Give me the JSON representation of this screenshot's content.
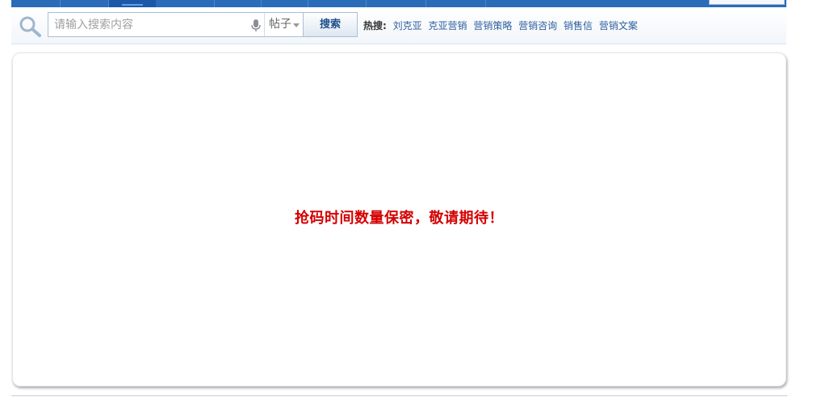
{
  "search": {
    "placeholder": "请输入搜索内容",
    "scope": "帖子",
    "button_label": "搜索"
  },
  "hot_search": {
    "label": "热搜:",
    "links": [
      "刘克亚",
      "克亚营销",
      "营销策略",
      "营销咨询",
      "销售信",
      "营销文案"
    ]
  },
  "content": {
    "notice": "抢码时间数量保密，敬请期待！"
  },
  "colors": {
    "nav_blue": "#2b6cb9",
    "notice_red": "#d40000",
    "link_blue": "#2f5f9e"
  }
}
